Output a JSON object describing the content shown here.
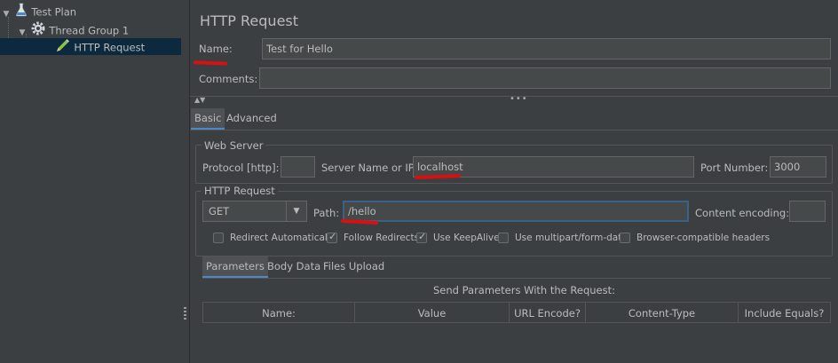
{
  "tree": {
    "items": [
      {
        "label": "Test Plan",
        "icon": "flask-icon"
      },
      {
        "label": "Thread Group 1",
        "icon": "gear-icon"
      },
      {
        "label": "HTTP Request",
        "icon": "pencil-icon"
      }
    ]
  },
  "panel": {
    "title": "HTTP Request",
    "name_label": "Name:",
    "name_value": "Test for Hello",
    "comments_label": "Comments:",
    "comments_value": "",
    "tabs": [
      "Basic",
      "Advanced"
    ],
    "web_server": {
      "legend": "Web Server",
      "protocol_label": "Protocol [http]:",
      "protocol_value": "",
      "server_label": "Server Name or IP:",
      "server_value": "localhost",
      "port_label": "Port Number:",
      "port_value": "3000"
    },
    "http_request": {
      "legend": "HTTP Request",
      "method": "GET",
      "path_label": "Path:",
      "path_value": "/hello",
      "encoding_label": "Content encoding:",
      "encoding_value": ""
    },
    "options": [
      {
        "label": "Redirect Automatically",
        "checked": false
      },
      {
        "label": "Follow Redirects",
        "checked": true
      },
      {
        "label": "Use KeepAlive",
        "checked": true
      },
      {
        "label": "Use multipart/form-data",
        "checked": false
      },
      {
        "label": "Browser-compatible headers",
        "checked": false
      }
    ],
    "subtabs": [
      "Parameters",
      "Body Data",
      "Files Upload"
    ],
    "params_caption": "Send Parameters With the Request:",
    "columns": [
      "Name:",
      "Value",
      "URL Encode?",
      "Content-Type",
      "Include Equals?"
    ]
  },
  "colors": {
    "background": "#3c3f41",
    "selection": "#0d293e",
    "annotation": "#d81010"
  }
}
